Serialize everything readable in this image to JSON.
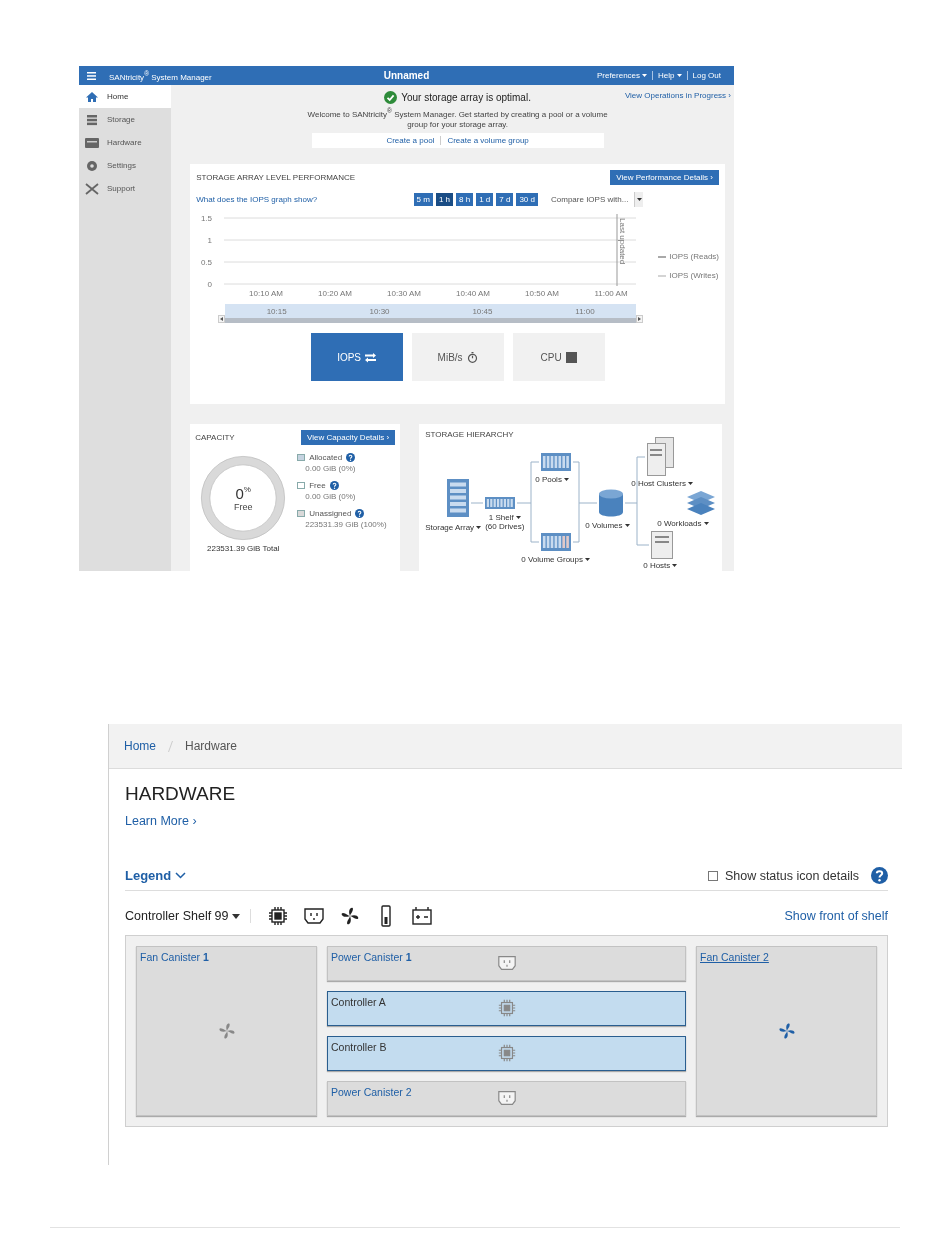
{
  "top_window": {
    "title": "SANtricity$^{®}$ System Manager",
    "array_name": "Unnamed",
    "menu": [
      {
        "label": "Preferences",
        "dropdown": true
      },
      {
        "label": "Help",
        "dropdown": true
      },
      {
        "label": "Log Out",
        "dropdown": false
      }
    ]
  },
  "sidebar": {
    "items": [
      {
        "label": "Home",
        "selected": true
      },
      {
        "label": "Storage",
        "selected": false
      },
      {
        "label": "Hardware",
        "selected": false
      },
      {
        "label": "Settings",
        "selected": false
      },
      {
        "label": "Support",
        "selected": false
      }
    ]
  },
  "status": {
    "message": "Your storage array is optimal.",
    "welcome": "Welcome to SANtricity$^{®}$ System Manager. Get started by creating a pool or a volume group for your storage array.",
    "actions": [
      "Create a pool",
      "Create a volume group"
    ],
    "operations_link": "View Operations in Progress ›"
  },
  "performance": {
    "title": "STORAGE ARRAY LEVEL PERFORMANCE",
    "details_button": "View Performance Details ›",
    "help_link": "What does the IOPS graph show?",
    "ranges": [
      {
        "label": "5 m",
        "selected": false
      },
      {
        "label": "1 h",
        "selected": true
      },
      {
        "label": "8 h",
        "selected": false
      },
      {
        "label": "1 d",
        "selected": false
      },
      {
        "label": "7 d",
        "selected": false
      },
      {
        "label": "30 d",
        "selected": false
      }
    ],
    "compare_select": "Compare IOPS with...",
    "navigator_labels": [
      "10:15",
      "10:30",
      "10:45",
      "11:00"
    ],
    "chart_data": {
      "type": "line",
      "x": [
        "10:10 AM",
        "10:20 AM",
        "10:30 AM",
        "10:40 AM",
        "10:50 AM",
        "11:00 AM"
      ],
      "series": [
        {
          "name": "IOPS (Reads)",
          "color": "#555555",
          "values": [
            null,
            null,
            null,
            null,
            null,
            null
          ]
        },
        {
          "name": "IOPS (Writes)",
          "color": "#aaaaaa",
          "values": [
            null,
            null,
            null,
            null,
            null,
            null
          ]
        }
      ],
      "ylim": [
        0,
        1.5
      ],
      "yticks": [
        0,
        0.5,
        1,
        1.5
      ],
      "legend": "right",
      "ref_lines": [
        {
          "axis": "x",
          "value": "11:00 AM",
          "label": "Last updated"
        }
      ]
    },
    "metrics": [
      {
        "label": "IOPS",
        "selected": true
      },
      {
        "label": "MiB/s",
        "selected": false
      },
      {
        "label": "CPU",
        "selected": false
      }
    ]
  },
  "capacity": {
    "title": "CAPACITY",
    "details_button": "View Capacity Details ›",
    "percent": "0",
    "percent_sign": "%",
    "percent_label": "Free",
    "total": "223531.39 GiB Total",
    "legend": [
      {
        "label": "Allocated",
        "value": "0.00 GiB (0%)",
        "color": "#c5d3e0"
      },
      {
        "label": "Free",
        "value": "0.00 GiB (0%)",
        "color": "#ffffff"
      },
      {
        "label": "Unassigned",
        "value": "223531.39 GiB (100%)",
        "color": "#d9d9d9"
      }
    ]
  },
  "hierarchy": {
    "title": "STORAGE HIERARCHY",
    "nodes": [
      {
        "kind": "array",
        "label": "Storage Array"
      },
      {
        "kind": "shelf",
        "label": "1 Shelf",
        "sublabel": "(60 Drives)"
      },
      {
        "kind": "pools",
        "label": "0 Pools"
      },
      {
        "kind": "volume_groups",
        "label": "0 Volume Groups"
      },
      {
        "kind": "volumes",
        "label": "0 Volumes"
      },
      {
        "kind": "host_clusters",
        "label": "0 Host Clusters"
      },
      {
        "kind": "workloads",
        "label": "0 Workloads"
      },
      {
        "kind": "hosts",
        "label": "0 Hosts"
      }
    ]
  },
  "hardware": {
    "breadcrumb": [
      {
        "label": "Home",
        "link": true
      },
      {
        "label": "Hardware",
        "link": false
      }
    ],
    "title": "HARDWARE",
    "learn_more": "Learn More ›",
    "legend": {
      "label": "Legend",
      "expanded": false
    },
    "status_details": {
      "label": "Show status icon details",
      "checked": false
    },
    "shelf_select": "Controller Shelf 99",
    "front_link": "Show front of shelf",
    "filters": [
      {
        "kind": "controller"
      },
      {
        "kind": "power"
      },
      {
        "kind": "fan"
      },
      {
        "kind": "drive"
      },
      {
        "kind": "battery"
      }
    ],
    "components": [
      {
        "kind": "fan",
        "label": "Fan Canister **1**",
        "selected": false,
        "hovered": false
      },
      {
        "kind": "power",
        "label": "Power Canister **1**",
        "selected": false,
        "hovered": false
      },
      {
        "kind": "controller",
        "label": "Controller A",
        "selected": true,
        "hovered": false
      },
      {
        "kind": "controller",
        "label": "Controller B",
        "selected": true,
        "hovered": false
      },
      {
        "kind": "power",
        "label": "Power Canister 2",
        "selected": false,
        "hovered": false
      },
      {
        "kind": "fan",
        "label": "Fan Canister 2",
        "selected": false,
        "hovered": true
      }
    ]
  }
}
